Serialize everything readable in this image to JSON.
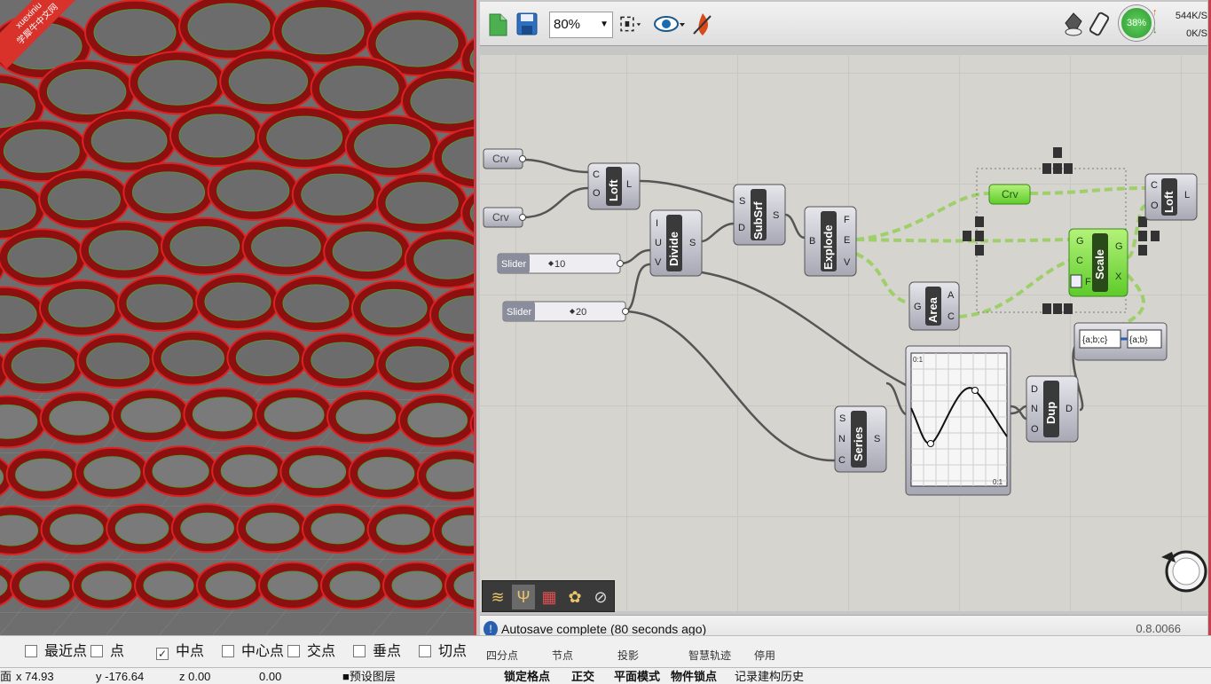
{
  "watermark": {
    "line1": "xuexiniu",
    "line2": "学犀牛中文网"
  },
  "toolbar": {
    "zoom": "80%",
    "cpu": "38%",
    "upload_speed": "544K/S",
    "download_speed": "0K/S",
    "up_arrow": "↑",
    "down_arrow": "↓"
  },
  "nodes": {
    "crv1": "Crv",
    "crv2": "Crv",
    "slider1_label": "Slider",
    "slider1_value": "10",
    "slider2_label": "Slider",
    "slider2_value": "20",
    "loft1": {
      "title": "Loft",
      "in1": "C",
      "in2": "O",
      "out1": "L"
    },
    "divide": {
      "title": "Divide",
      "in1": "I",
      "in2": "U",
      "in3": "V",
      "out1": "S"
    },
    "subsrf": {
      "title": "SubSrf",
      "in1": "S",
      "in2": "D",
      "out1": "S"
    },
    "explode": {
      "title": "Explode",
      "in1": "B",
      "out1": "F",
      "out2": "E",
      "out3": "V"
    },
    "area": {
      "title": "Area",
      "in1": "G",
      "out1": "A",
      "out2": "C"
    },
    "crv_green": "Crv",
    "scale": {
      "title": "Scale",
      "in1": "G",
      "in2": "C",
      "in3": "F",
      "out1": "G",
      "out2": "X"
    },
    "loft2": {
      "title": "Loft",
      "in1": "C",
      "in2": "O",
      "out1": "L"
    },
    "param_viewer": {
      "left": "{a;b;c}",
      "right": "{a;b}"
    },
    "graph": {
      "corner_tl": "0:1",
      "corner_br": "0:1"
    },
    "series": {
      "title": "Series",
      "in1": "S",
      "in2": "N",
      "in3": "C",
      "out1": "S"
    },
    "dup": {
      "title": "Dup",
      "in1": "D",
      "in2": "N",
      "in3": "O",
      "out1": "D"
    }
  },
  "status": {
    "message": "Autosave complete (80 seconds ago)",
    "version": "0.8.0066",
    "info_glyph": "!"
  },
  "osnaps": [
    {
      "label": "最近点",
      "checked": false
    },
    {
      "label": "点",
      "checked": false
    },
    {
      "label": "中点",
      "checked": true
    },
    {
      "label": "中心点",
      "checked": false
    },
    {
      "label": "交点",
      "checked": false
    },
    {
      "label": "垂点",
      "checked": false
    },
    {
      "label": "切点",
      "checked": false
    }
  ],
  "osnaps2": [
    "四分点",
    "节点",
    "投影",
    "智慧轨迹",
    "停用"
  ],
  "coords": {
    "x": "x 74.93",
    "y": "y -176.64",
    "z": "z 0.00",
    "d": "0.00",
    "layer": "■预设图层",
    "btn1": "锁定格点",
    "btn2": "正交",
    "btn3": "平面模式",
    "btn4": "物件锁点",
    "btn5": "记录建构历史",
    "prefix": "面"
  }
}
